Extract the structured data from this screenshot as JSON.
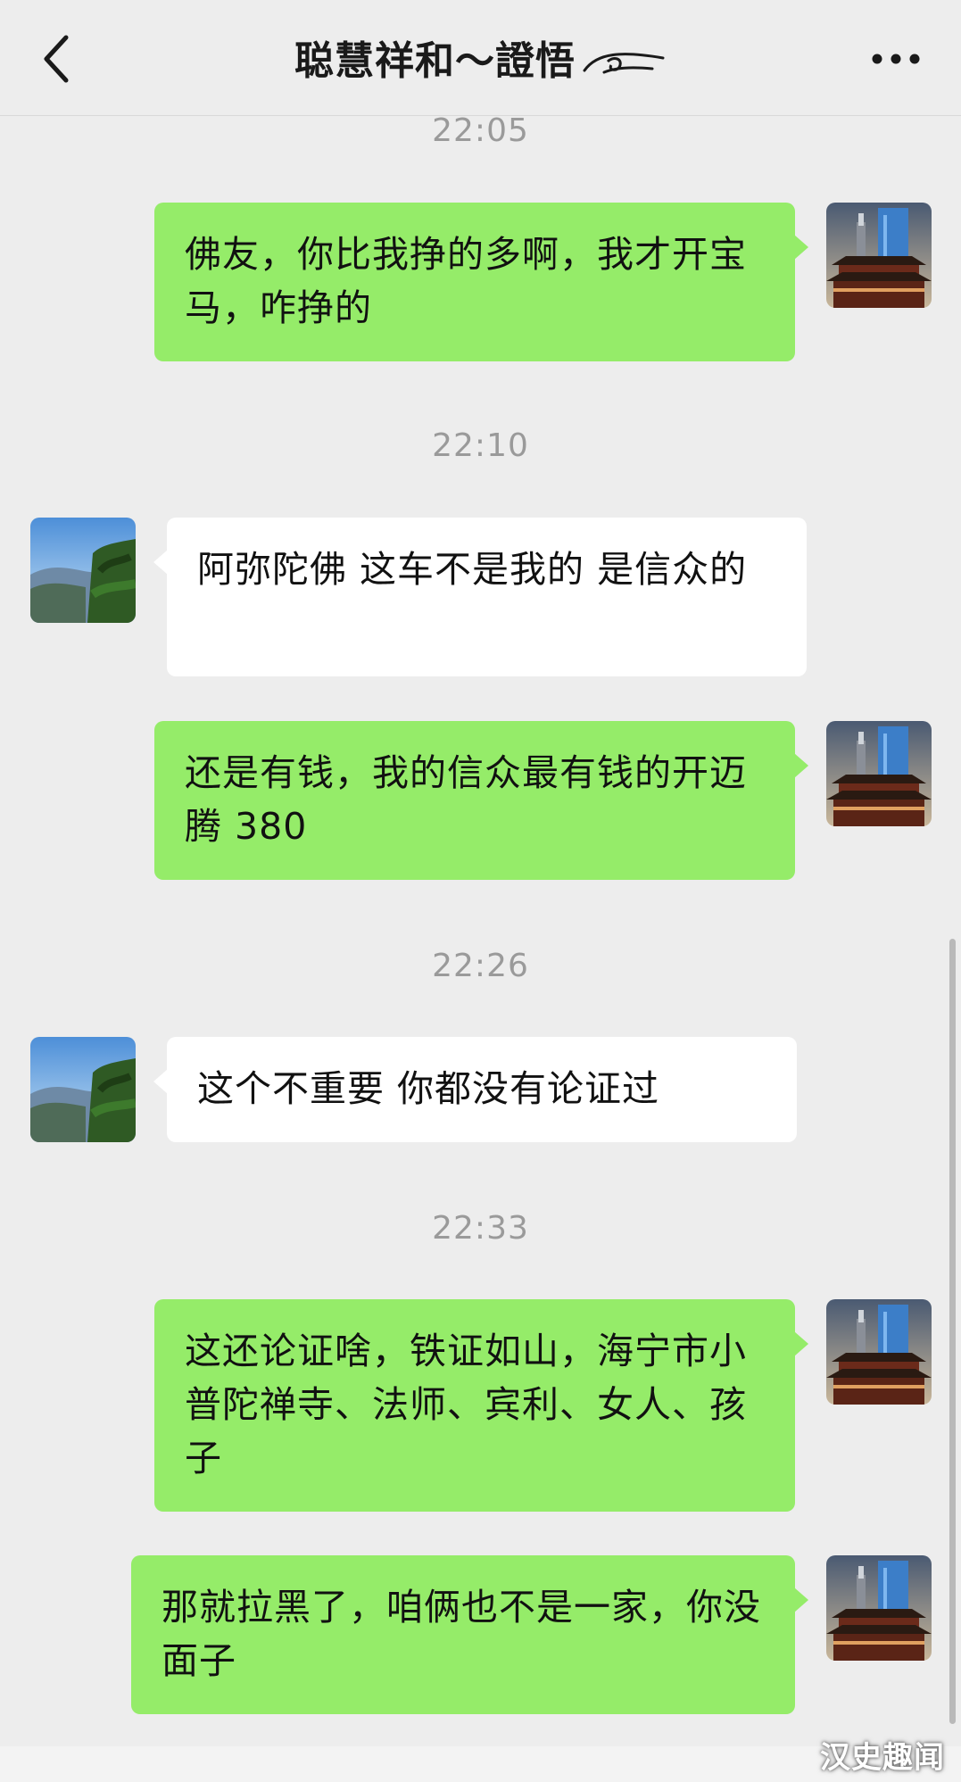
{
  "header": {
    "title": "聪慧祥和～證悟",
    "back_icon": "chevron-left-icon",
    "more_icon": "more-dots-icon"
  },
  "messages": [
    {
      "time": "22:05"
    },
    {
      "sender": "self",
      "text": "佛友，你比我挣的多啊，我才开宝马，咋挣的"
    },
    {
      "time": "22:10"
    },
    {
      "sender": "other",
      "text": "阿弥陀佛  这车不是我的  是信众的"
    },
    {
      "sender": "self",
      "text": "还是有钱，我的信众最有钱的开迈腾 380"
    },
    {
      "time": "22:26"
    },
    {
      "sender": "other",
      "text": "这个不重要   你都没有论证过"
    },
    {
      "time": "22:33"
    },
    {
      "sender": "self",
      "text": "这还论证啥，铁证如山，海宁市小普陀禅寺、法师、宾利、女人、孩子"
    },
    {
      "sender": "self",
      "text": "那就拉黑了，咱俩也不是一家，你没面子"
    }
  ],
  "watermark": "汉史趣闻",
  "colors": {
    "background": "#ededed",
    "self_bubble": "#95ec69",
    "other_bubble": "#ffffff",
    "timestamp": "#9a9a9a"
  }
}
